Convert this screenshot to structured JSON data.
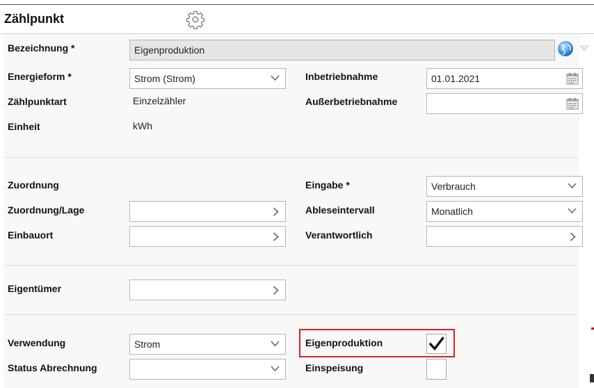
{
  "header": {
    "title": "Zählpunkt"
  },
  "icons": {
    "settings": "gear-icon",
    "translate": "globe-icon",
    "dropdown": "chevron-down-icon",
    "lookup": "chevron-right-icon",
    "date": "calendar-icon",
    "check": "checkmark-icon"
  },
  "colors": {
    "highlight": "#d2232a",
    "readonly_bg": "#e6e6e6",
    "panel_bg": "#f8f8f8"
  },
  "section_general": {
    "bezeichnung": {
      "label": "Bezeichnung *",
      "value": "Eigenproduktion"
    },
    "energieform": {
      "label": "Energieform *",
      "value": "Strom (Strom)"
    },
    "zaehlpunktart": {
      "label": "Zählpunktart",
      "value": "Einzelzähler"
    },
    "einheit": {
      "label": "Einheit",
      "value": "kWh"
    },
    "inbetriebnahme": {
      "label": "Inbetriebnahme",
      "value": "01.01.2021"
    },
    "ausserbetriebnahme": {
      "label": "Außerbetriebnahme",
      "value": ""
    }
  },
  "section_assignment": {
    "zuordnung": {
      "label": "Zuordnung"
    },
    "zuordnung_lage": {
      "label": "Zuordnung/Lage",
      "value": ""
    },
    "einbauort": {
      "label": "Einbauort",
      "value": ""
    },
    "eingabe": {
      "label": "Eingabe *",
      "value": "Verbrauch"
    },
    "ableseintervall": {
      "label": "Ableseintervall",
      "value": "Monatlich"
    },
    "verantwortlich": {
      "label": "Verantwortlich",
      "value": ""
    }
  },
  "section_owner": {
    "eigentuemer": {
      "label": "Eigentümer",
      "value": ""
    }
  },
  "section_usage": {
    "verwendung": {
      "label": "Verwendung",
      "value": "Strom"
    },
    "status_abrechnung": {
      "label": "Status Abrechnung",
      "value": ""
    },
    "eigenproduktion": {
      "label": "Eigenproduktion",
      "checked": true
    },
    "einspeisung": {
      "label": "Einspeisung",
      "checked": false
    }
  }
}
